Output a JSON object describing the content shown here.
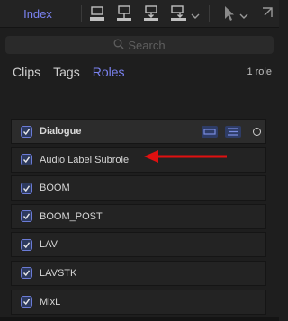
{
  "toolbar": {
    "index_label": "Index",
    "buttons": [
      "clip-overwrite-icon",
      "clip-connect-icon",
      "clip-insert-icon",
      "clip-append-icon",
      "select-tool-icon",
      "fullscreen-icon"
    ]
  },
  "search": {
    "placeholder": "Search",
    "icon": "search-icon"
  },
  "tabs": [
    {
      "label": "Clips",
      "active": false
    },
    {
      "label": "Tags",
      "active": false
    },
    {
      "label": "Roles",
      "active": true
    }
  ],
  "role_count": "1 role",
  "roles_header": {
    "label": "Dialogue",
    "checked": true
  },
  "subroles": [
    {
      "label": "Audio Label Subrole",
      "checked": true
    },
    {
      "label": "BOOM",
      "checked": true
    },
    {
      "label": "BOOM_POST",
      "checked": true
    },
    {
      "label": "LAV",
      "checked": true
    },
    {
      "label": "LAVSTK",
      "checked": true
    },
    {
      "label": "MixL",
      "checked": true
    }
  ],
  "colors": {
    "accent": "#7a82f0",
    "annotation_arrow": "#e01010"
  }
}
